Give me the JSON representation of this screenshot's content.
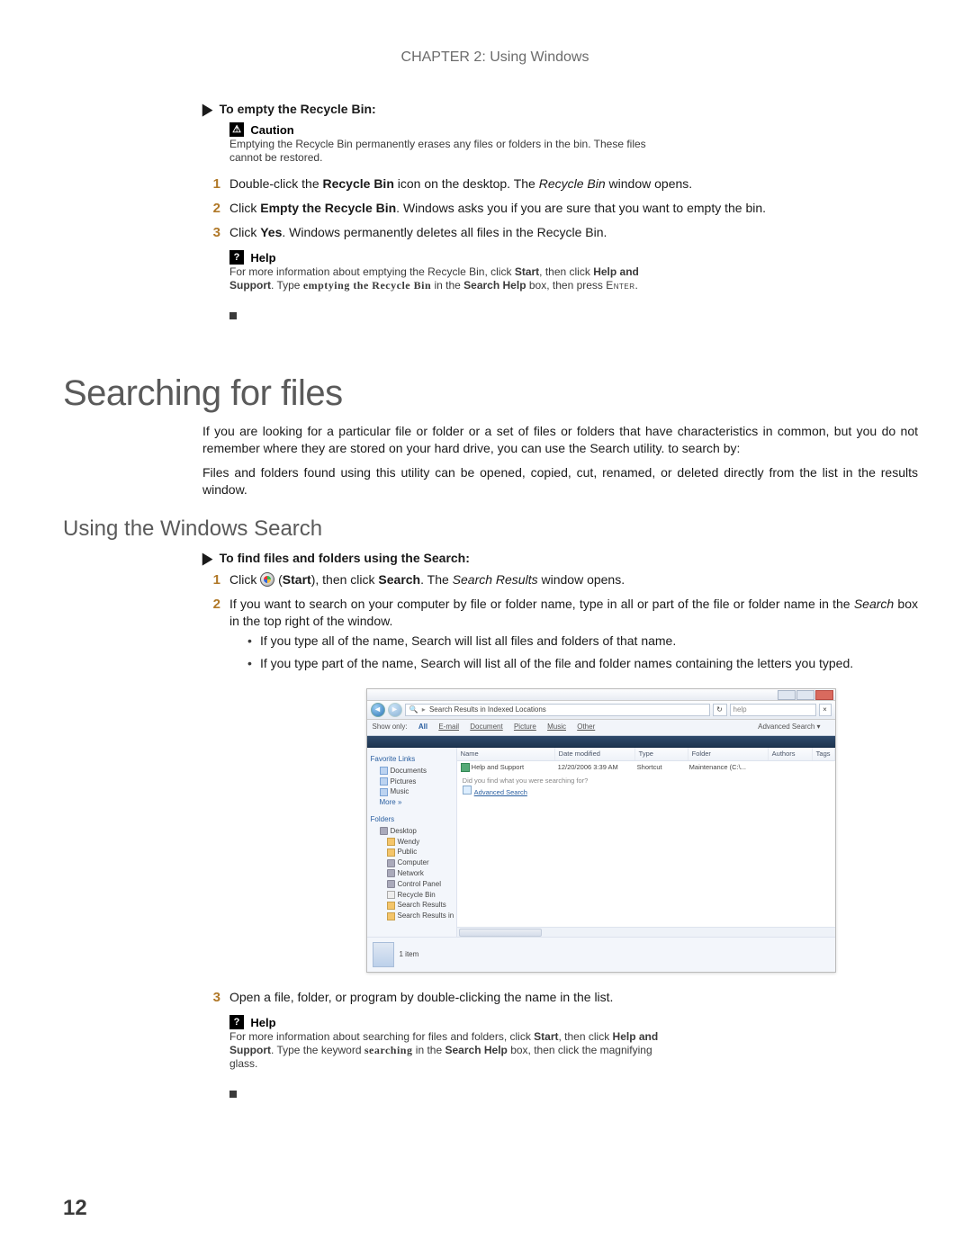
{
  "chapter_header": "CHAPTER 2: Using Windows",
  "page_number": "12",
  "empty_bin": {
    "proc_title": "To empty the Recycle Bin:",
    "caution_label": "Caution",
    "caution_text": "Emptying the Recycle Bin permanently erases any files or folders in the bin. These files cannot be restored.",
    "step1_a": "Double-click the ",
    "step1_b": "Recycle Bin",
    "step1_c": " icon on the desktop. The ",
    "step1_d": "Recycle Bin",
    "step1_e": " window opens.",
    "step2_a": "Click ",
    "step2_b": "Empty the Recycle Bin",
    "step2_c": ". Windows asks you if you are sure that you want to empty the bin.",
    "step3_a": "Click ",
    "step3_b": "Yes",
    "step3_c": ". Windows permanently deletes all files in the Recycle Bin.",
    "help_label": "Help",
    "help_a": "For more information about emptying the Recycle Bin, click ",
    "help_b": "Start",
    "help_c": ", then click ",
    "help_d": "Help and Support",
    "help_e": ". Type ",
    "help_f": "emptying the Recycle Bin",
    "help_g": " in the ",
    "help_h": "Search Help",
    "help_i": " box, then press ",
    "help_j": "Enter",
    "help_k": "."
  },
  "searching": {
    "title": "Searching for files",
    "p1": "If you are looking for a particular file or folder or a set of files or folders that have characteristics in common, but you do not remember where they are stored on your hard drive, you can use the Search utility. to search by:",
    "p2": "Files and folders found using this utility can be opened, copied, cut, renamed, or deleted directly from the list in the results window."
  },
  "using_search": {
    "title": "Using the Windows Search",
    "proc_title": "To find files and folders using the Search:",
    "step1_a": "Click ",
    "step1_b": " (",
    "step1_c": "Start",
    "step1_d": "), then click ",
    "step1_e": "Search",
    "step1_f": ". The ",
    "step1_g": "Search Results",
    "step1_h": " window opens.",
    "step2_a": "If you want to search on your computer by file or folder name, type in all or part of the file or folder name in the ",
    "step2_b": "Search",
    "step2_c": " box in the top right of the window.",
    "bullet1": "If you type all of the name, Search will list all files and folders of that name.",
    "bullet2": "If you type part of the name, Search will list all of the file and folder names containing the letters you typed.",
    "step3": "Open a file, folder, or program by double-clicking the name in the list.",
    "help_label": "Help",
    "help_a": "For more information about searching for files and folders, click ",
    "help_b": "Start",
    "help_c": ", then click ",
    "help_d": "Help and Support",
    "help_e": ". Type the keyword ",
    "help_f": "searching",
    "help_g": " in the ",
    "help_h": "Search Help",
    "help_i": " box, then click the magnifying glass."
  },
  "mock": {
    "breadcrumb": "Search Results in Indexed Locations",
    "search_placeholder": "help",
    "refresh": "↻",
    "filters": {
      "showonly": "Show only:",
      "all": "All",
      "email": "E-mail",
      "document": "Document",
      "picture": "Picture",
      "music": "Music",
      "other": "Other",
      "advanced": "Advanced Search ▾"
    },
    "cols": {
      "name": "Name",
      "date": "Date modified",
      "type": "Type",
      "folder": "Folder",
      "authors": "Authors",
      "tags": "Tags"
    },
    "row1": {
      "name": "Help and Support",
      "date": "12/20/2006 3:39 AM",
      "type": "Shortcut",
      "folder": "Maintenance (C:\\..."
    },
    "hint_q": "Did you find what you were searching for?",
    "hint_link": "Advanced Search",
    "side": {
      "fav_head": "Favorite Links",
      "documents": "Documents",
      "pictures": "Pictures",
      "music": "Music",
      "more": "More »",
      "folders_head": "Folders",
      "desktop": "Desktop",
      "wendy": "Wendy",
      "public": "Public",
      "computer": "Computer",
      "network": "Network",
      "cpanel": "Control Panel",
      "recycle": "Recycle Bin",
      "sresults": "Search Results",
      "sindexed": "Search Results in Inde..."
    },
    "details_count": "1 item"
  }
}
